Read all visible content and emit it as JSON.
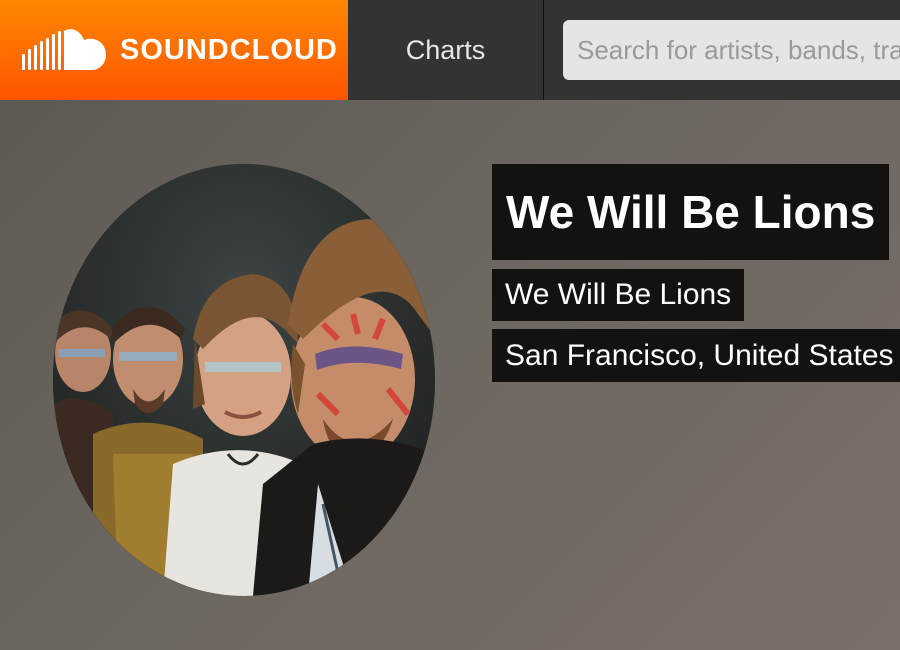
{
  "header": {
    "logo_text": "SOUNDCLOUD",
    "logo_icon": "soundcloud-cloud-icon",
    "nav_charts_label": "Charts",
    "search_placeholder": "Search for artists, bands, tracks, podcasts"
  },
  "profile": {
    "name": "We Will Be Lions",
    "username": "We Will Be Lions",
    "location": "San Francisco, United States",
    "avatar_icon": "band-photo-avatar"
  },
  "colors": {
    "brand_orange": "#ff5500",
    "topbar": "#333333",
    "label_bg": "#141211"
  }
}
